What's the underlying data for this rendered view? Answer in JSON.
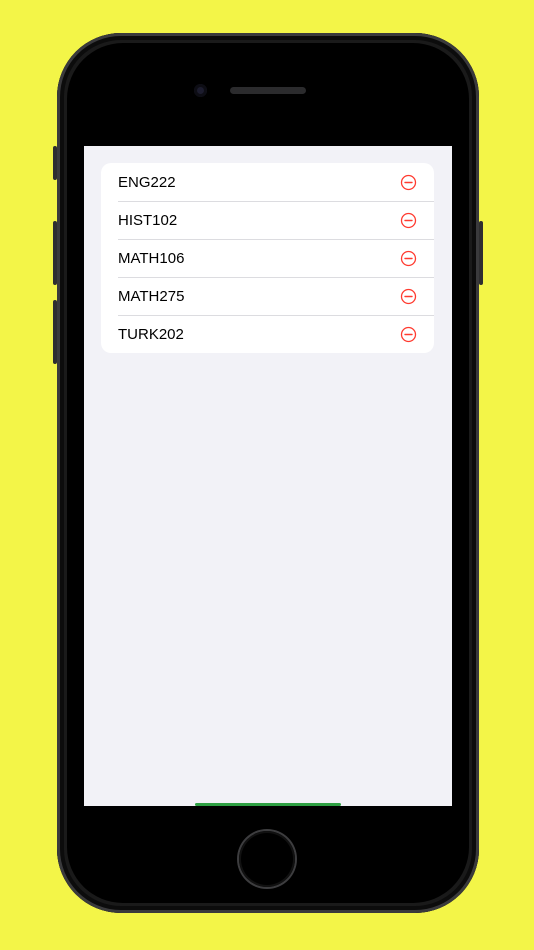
{
  "courses": [
    {
      "label": "ENG222"
    },
    {
      "label": "HIST102"
    },
    {
      "label": "MATH106"
    },
    {
      "label": "MATH275"
    },
    {
      "label": "TURK202"
    }
  ],
  "icons": {
    "remove": "minus-circle-icon",
    "remove_color": "#ff3b30"
  },
  "colors": {
    "background": "#f3f548",
    "screen_background": "#f2f2f7",
    "list_background": "#ffffff",
    "home_indicator": "#2ea043"
  }
}
